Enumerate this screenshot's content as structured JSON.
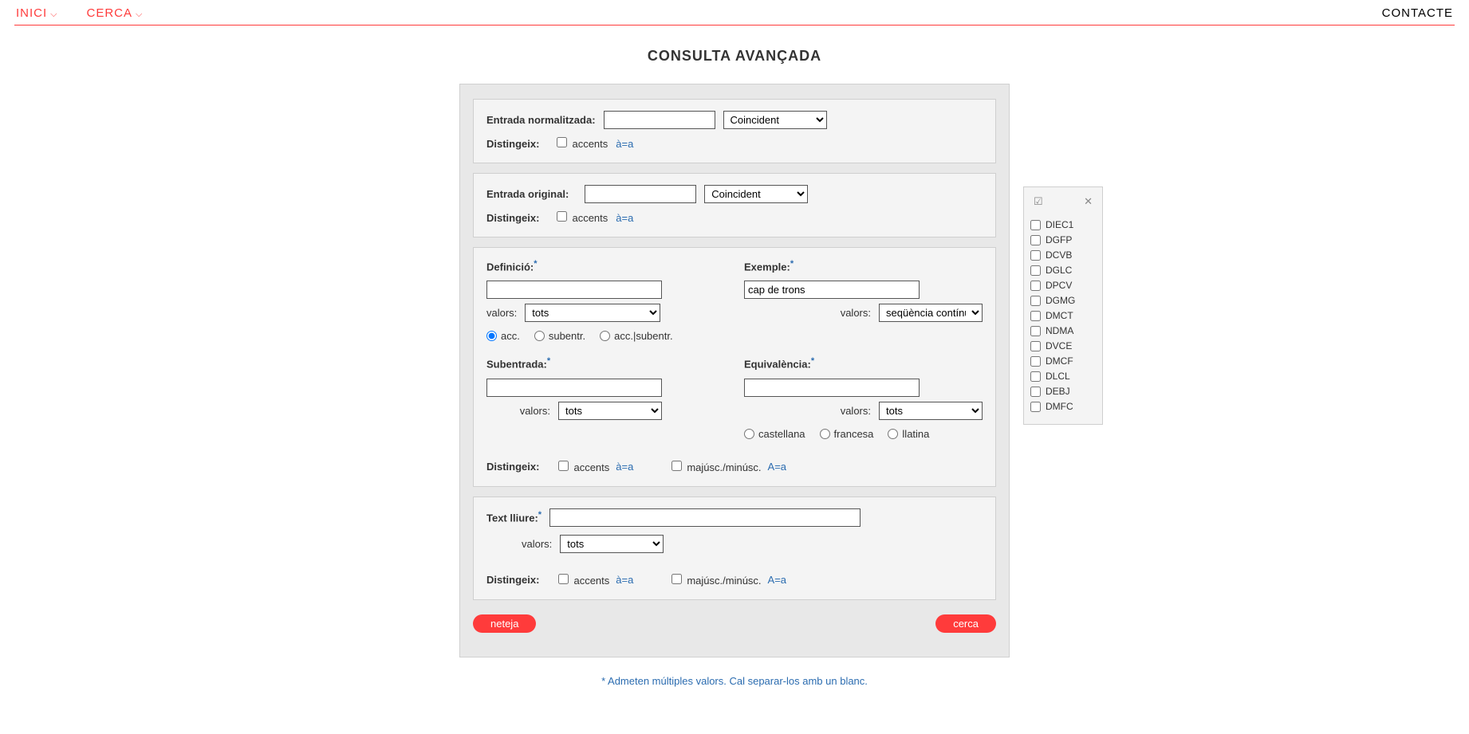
{
  "nav": {
    "inici": "INICI",
    "cerca": "CERCA",
    "contacte": "CONTACTE"
  },
  "title": "CONSULTA AVANÇADA",
  "p1": {
    "label": "Entrada normalitzada:",
    "select": "Coincident",
    "distingeix": "Distingeix:",
    "accents": "accents",
    "aea": "à=a"
  },
  "p2": {
    "label": "Entrada original:",
    "select": "Coincident",
    "distingeix": "Distingeix:",
    "accents": "accents",
    "aea": "à=a"
  },
  "p3": {
    "def_label": "Definició:",
    "ex_label": "Exemple:",
    "ex_value": "cap de trons",
    "valors": "valors:",
    "tots": "tots",
    "seq": "seqüència contínua",
    "r_acc": "acc.",
    "r_sub": "subentr.",
    "r_accsub": "acc.|subentr.",
    "sub_label": "Subentrada:",
    "eq_label": "Equivalència:",
    "r_cast": "castellana",
    "r_fr": "francesa",
    "r_lat": "llatina",
    "distingeix": "Distingeix:",
    "accents": "accents",
    "aea": "à=a",
    "maj": "majúsc./minúsc.",
    "Aa": "A=a"
  },
  "p4": {
    "label": "Text lliure:",
    "valors": "valors:",
    "tots": "tots",
    "distingeix": "Distingeix:",
    "accents": "accents",
    "aea": "à=a",
    "maj": "majúsc./minúsc.",
    "Aa": "A=a"
  },
  "btn": {
    "neteja": "neteja",
    "cerca": "cerca"
  },
  "dicts": [
    "DIEC1",
    "DGFP",
    "DCVB",
    "DGLC",
    "DPCV",
    "DGMG",
    "DMCT",
    "NDMA",
    "DVCE",
    "DMCF",
    "DLCL",
    "DEBJ",
    "DMFC"
  ],
  "footnote": "* Admeten múltiples valors. Cal separar-los amb un blanc."
}
